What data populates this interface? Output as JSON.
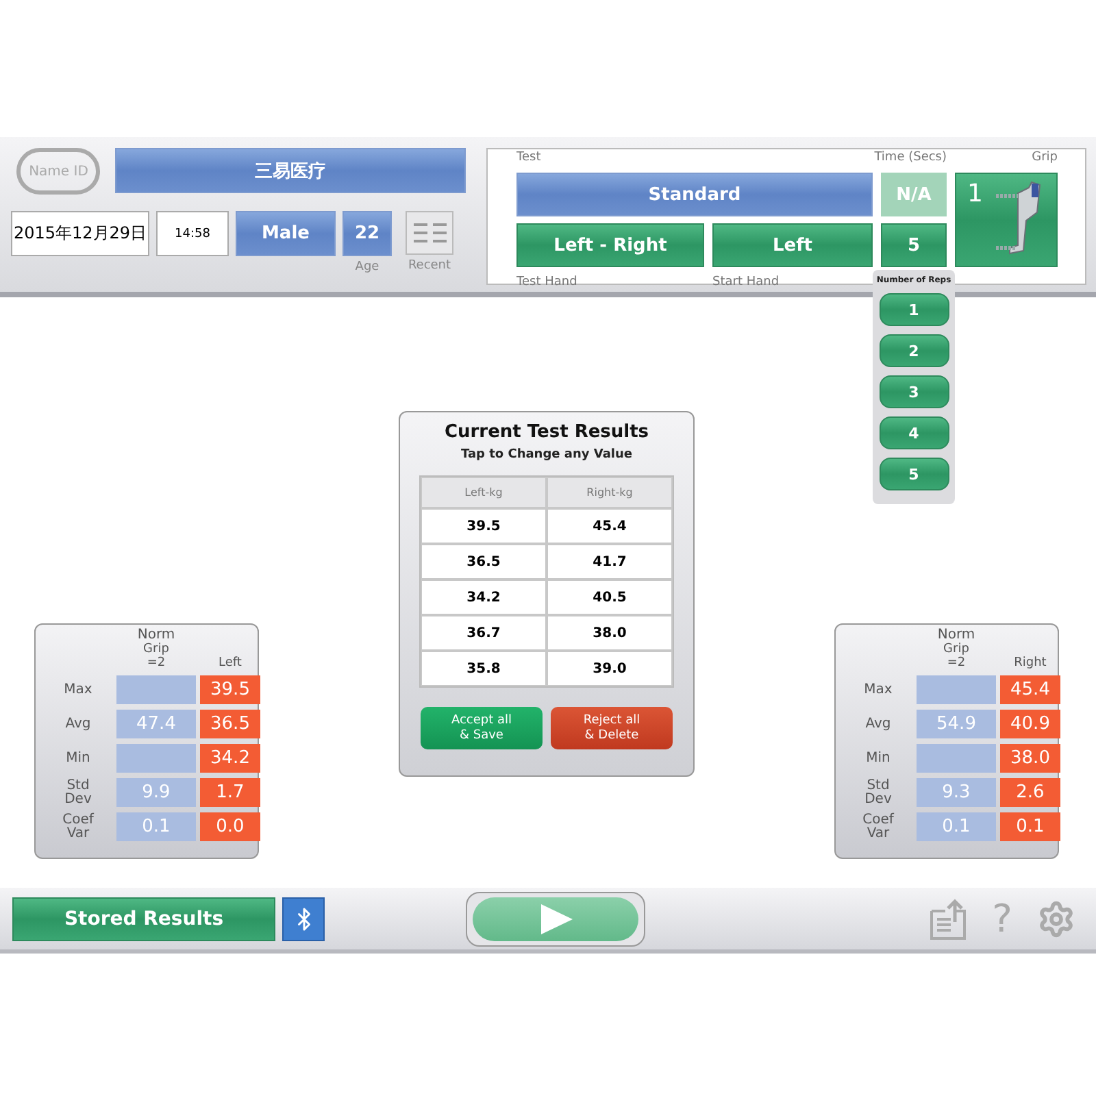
{
  "header": {
    "name_id_label": "Name ID",
    "patient_name": "三易医疗",
    "date": "2015年12月29日",
    "time": "14:58",
    "gender": "Male",
    "age": "22",
    "age_label": "Age",
    "recent_label": "Recent"
  },
  "test_setup": {
    "test_label": "Test",
    "test": "Standard",
    "time_label": "Time (Secs)",
    "time": "N/A",
    "grip_label": "Grip",
    "grip": "1",
    "test_hand": "Left - Right",
    "test_hand_label": "Test Hand",
    "start_hand": "Left",
    "start_hand_label": "Start Hand",
    "reps": "5"
  },
  "reps_menu": {
    "title": "Number of Reps",
    "options": [
      "1",
      "2",
      "3",
      "4",
      "5"
    ]
  },
  "results": {
    "title": "Current Test Results",
    "subtitle": "Tap to Change any Value",
    "columns": [
      "Left-kg",
      "Right-kg"
    ],
    "rows": [
      [
        "39.5",
        "45.4"
      ],
      [
        "36.5",
        "41.7"
      ],
      [
        "34.2",
        "40.5"
      ],
      [
        "36.7",
        "38.0"
      ],
      [
        "35.8",
        "39.0"
      ]
    ],
    "buttons": [
      {
        "kind": "accept",
        "lines": [
          "Accept all",
          "& Save"
        ]
      },
      {
        "kind": "reject",
        "lines": [
          "Reject all",
          "& Delete"
        ]
      }
    ]
  },
  "stats": [
    {
      "norm_title": "Norm",
      "norm_subtitle": "Grip =2",
      "hand": "Left",
      "rows": [
        {
          "label": "Max",
          "value": "39.5"
        },
        {
          "label": "Avg",
          "norm": "47.4",
          "value": "36.5"
        },
        {
          "label": "Min",
          "value": "34.2"
        },
        {
          "label": "Std Dev",
          "norm": "9.9",
          "value": "1.7"
        },
        {
          "label": "Coef Var",
          "norm": "0.1",
          "value": "0.0"
        }
      ]
    },
    {
      "norm_title": "Norm",
      "norm_subtitle": "Grip =2",
      "hand": "Right",
      "rows": [
        {
          "label": "Max",
          "value": "45.4"
        },
        {
          "label": "Avg",
          "norm": "54.9",
          "value": "40.9"
        },
        {
          "label": "Min",
          "value": "38.0"
        },
        {
          "label": "Std Dev",
          "norm": "9.3",
          "value": "2.6"
        },
        {
          "label": "Coef Var",
          "norm": "0.1",
          "value": "0.1"
        }
      ]
    }
  ],
  "footer": {
    "stored_results": "Stored Results",
    "help": "?"
  }
}
